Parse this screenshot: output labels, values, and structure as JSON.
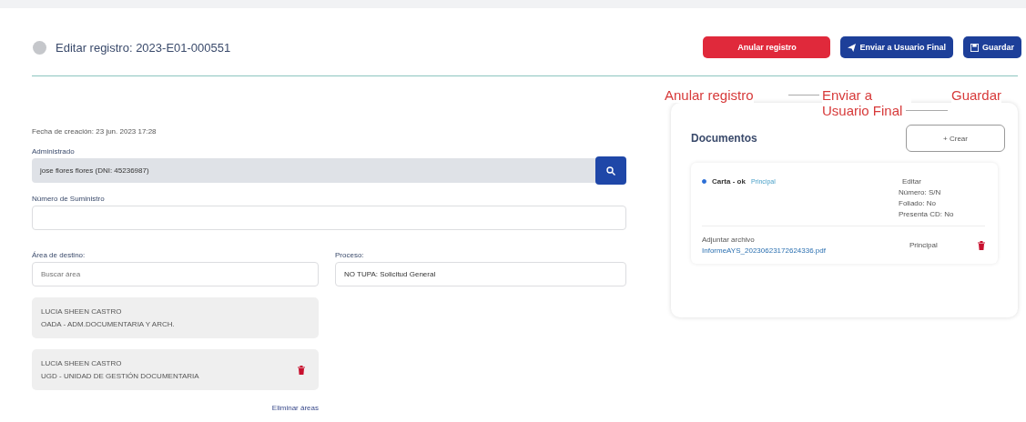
{
  "header": {
    "title": "Editar registro: 2023-E01-000551"
  },
  "actions": [
    {
      "label": "Anular registro",
      "kind": "danger"
    },
    {
      "label": "Enviar a Usuario Final",
      "kind": "send"
    },
    {
      "label": "Guardar",
      "kind": "save"
    }
  ],
  "annotations": [
    "Anular registro",
    "Enviar a Usuario Final",
    "Guardar"
  ],
  "form": {
    "created": "Fecha de creación: 23 jun. 2023 17:28",
    "administrado": {
      "label": "Administrado",
      "value": "jose flores flores (DNI: 45236987)",
      "disabled": true
    },
    "suministro": {
      "label": "Número de Suministro"
    },
    "area": {
      "label": "Área de destino:",
      "placeholder": "Buscar área"
    },
    "proceso": {
      "label": "Proceso:",
      "value": "NO TUPA: Solicitud General"
    },
    "areas": [
      {
        "name": "LUCIA SHEEN CASTRO",
        "unit": "OADA - ADM.DOCUMENTARIA Y ARCH.",
        "deletable": false
      },
      {
        "name": "LUCIA SHEEN CASTRO",
        "unit": "UGD - UNIDAD DE GESTIÓN DOCUMENTARIA",
        "deletable": true
      }
    ],
    "remove_link": "Eliminar áreas"
  },
  "documents": {
    "title": "Documentos",
    "create": "+ Crear",
    "items": [
      {
        "name": "Carta - ok",
        "badge": "Principal",
        "selected": true,
        "edit": "Editar",
        "details": [
          "Número: S/N",
          "Foliado: No",
          "Presenta CD: No"
        ],
        "attach_label": "Adjuntar archivo",
        "file": "InformeAYS_20230623172624336.pdf",
        "file_tag": "Principal"
      }
    ]
  }
}
